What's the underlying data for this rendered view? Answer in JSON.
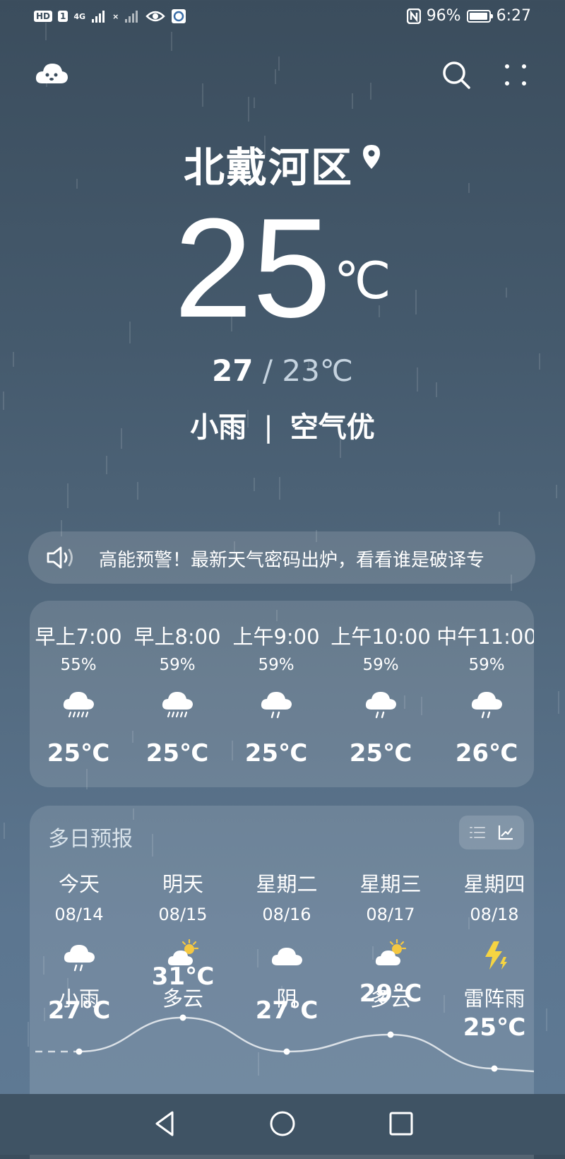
{
  "status_bar": {
    "left_chips": [
      "HD",
      "1"
    ],
    "signal_1": "4G",
    "signal_2": "×",
    "battery_percent": "96%",
    "battery_level": 0.96,
    "time": "6:27"
  },
  "location": {
    "name": "北戴河区",
    "pin_icon": "location-pin-icon"
  },
  "current": {
    "temperature": "25",
    "unit": "℃",
    "high": "27",
    "separator": "/",
    "low": "23℃",
    "condition": "小雨",
    "divider": "|",
    "air_quality": "空气优"
  },
  "alert": {
    "icon": "speaker-icon",
    "text": "高能预警！最新天气密码出炉，看看谁是破译专"
  },
  "hourly": [
    {
      "time": "早上7:00",
      "humidity": "55%",
      "icon": "rain-cloud-icon",
      "temp": "25℃"
    },
    {
      "time": "早上8:00",
      "humidity": "59%",
      "icon": "rain-cloud-icon",
      "temp": "25℃"
    },
    {
      "time": "上午9:00",
      "humidity": "59%",
      "icon": "light-rain-icon",
      "temp": "25℃"
    },
    {
      "time": "上午10:00",
      "humidity": "59%",
      "icon": "light-rain-icon",
      "temp": "25℃"
    },
    {
      "time": "中午11:00",
      "humidity": "59%",
      "icon": "light-rain-icon",
      "temp": "26℃"
    }
  ],
  "daily": {
    "title": "多日预报",
    "toggle_icons": [
      "list-view-icon",
      "chart-view-icon"
    ],
    "days": [
      {
        "day": "今天",
        "date": "08/14",
        "icon": "light-rain-icon",
        "condition": "小雨",
        "high": "27℃",
        "high_value": 27
      },
      {
        "day": "明天",
        "date": "08/15",
        "icon": "partly-cloudy-icon",
        "condition": "多云",
        "high": "31℃",
        "high_value": 31
      },
      {
        "day": "星期二",
        "date": "08/16",
        "icon": "overcast-icon",
        "condition": "阴",
        "high": "27℃",
        "high_value": 27
      },
      {
        "day": "星期三",
        "date": "08/17",
        "icon": "partly-cloudy-icon",
        "condition": "多云",
        "high": "29℃",
        "high_value": 29
      },
      {
        "day": "星期四",
        "date": "08/18",
        "icon": "thunderstorm-icon",
        "condition": "雷阵雨",
        "high": "25℃",
        "high_value": 25
      }
    ]
  },
  "colors": {
    "accent": "#ffffff",
    "sun": "#f5c842",
    "bolt": "#f5d442",
    "background_top": "#3b4d5d"
  }
}
